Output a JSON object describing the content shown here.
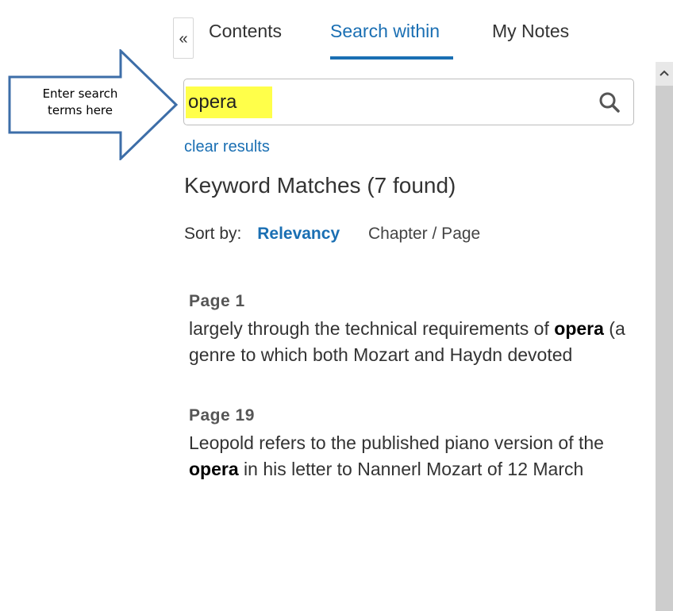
{
  "tabs": {
    "collapse_glyph": "«",
    "items": [
      {
        "label": "Contents",
        "active": false
      },
      {
        "label": "Search within",
        "active": true
      },
      {
        "label": "My Notes",
        "active": false
      }
    ]
  },
  "search": {
    "value": "opera",
    "highlight_color": "#ffff4a",
    "icon": "search-icon"
  },
  "clear_results_label": "clear results",
  "matches_heading": "Keyword Matches (7 found)",
  "sort": {
    "label": "Sort by:",
    "options": [
      "Relevancy",
      "Chapter / Page"
    ],
    "selected": "Relevancy"
  },
  "results": [
    {
      "page": "Page 1",
      "before": "largely through the technical requirements of ",
      "keyword": "opera",
      "after": " (a genre to which both Mozart and Haydn devoted"
    },
    {
      "page": "Page 19",
      "before": "Leopold refers to the published piano version of the ",
      "keyword": "opera",
      "after": " in his letter to Nannerl Mozart of 12 March"
    }
  ],
  "callout": {
    "line1": "Enter search",
    "line2": "terms here"
  },
  "colors": {
    "accent": "#1a6fb3",
    "callout_border": "#3d6ea8"
  }
}
